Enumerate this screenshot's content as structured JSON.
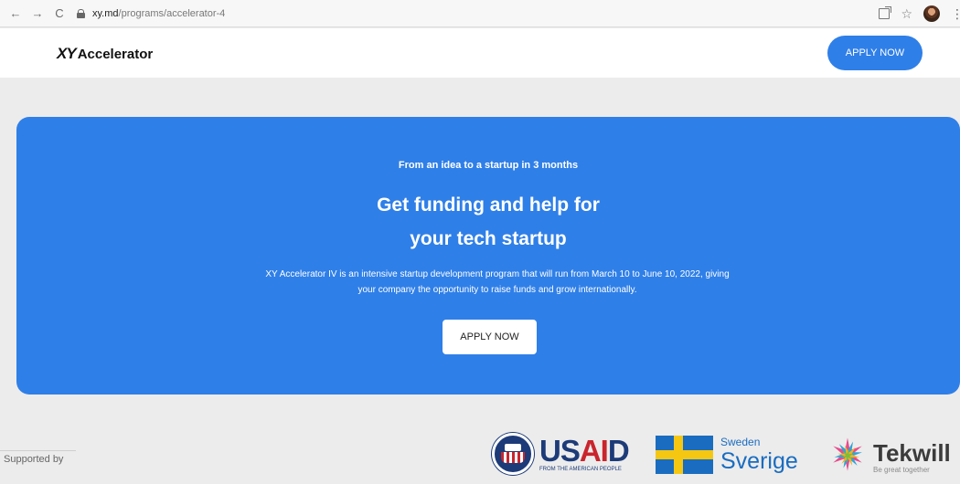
{
  "browser": {
    "back_glyph": "←",
    "forward_glyph": "→",
    "reload_glyph": "C",
    "url_host": "xy.md",
    "url_path": "/programs/accelerator-4",
    "star_glyph": "☆",
    "menu_glyph": "⋮",
    "icons": [
      "back-icon",
      "forward-icon",
      "reload-icon",
      "lock-icon",
      "share-icon",
      "bookmark-star-icon",
      "profile-avatar",
      "menu-icon"
    ]
  },
  "header": {
    "logo_mark": "XY",
    "logo_text": "Accelerator",
    "apply_label": "APPLY NOW"
  },
  "hero": {
    "kicker": "From an idea to a startup in 3 months",
    "title_line1": "Get funding and help for",
    "title_line2": "your tech startup",
    "description": "XY Accelerator IV is an intensive startup development program that will run from March 10 to June 10, 2022, giving your company the opportunity to raise funds and grow internationally.",
    "apply_label": "APPLY NOW"
  },
  "sponsors": {
    "label": "Supported by",
    "usaid": {
      "word_pre": "US",
      "word_mid": "AI",
      "word_post": "D",
      "tagline": "FROM THE AMERICAN PEOPLE"
    },
    "sweden": {
      "small": "Sweden",
      "big": "Sverige"
    },
    "tekwill": {
      "word": "Tekwill",
      "tagline": "Be great together"
    }
  },
  "colors": {
    "primary": "#2f7fe8",
    "usaid_blue": "#1d3b78",
    "usaid_red": "#c9252d",
    "sweden_blue": "#1a6cc0",
    "sweden_yellow": "#f5c713"
  }
}
